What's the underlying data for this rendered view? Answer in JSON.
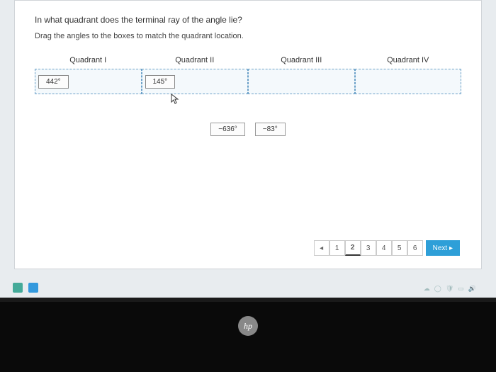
{
  "question": "In what quadrant does the terminal ray of the angle lie?",
  "instruction": "Drag the angles to the boxes to match the quadrant location.",
  "quadrants": [
    {
      "label": "Quadrant I"
    },
    {
      "label": "Quadrant II"
    },
    {
      "label": "Quadrant III"
    },
    {
      "label": "Quadrant IV"
    }
  ],
  "placed": {
    "q1": "442°",
    "q2": "145°"
  },
  "pool": {
    "a": "−636°",
    "b": "−83°"
  },
  "pager": {
    "prev": "◂",
    "pages": [
      "1",
      "2",
      "3",
      "4",
      "5",
      "6"
    ],
    "current": 2,
    "next": "Next ▸"
  },
  "logo": "hp"
}
